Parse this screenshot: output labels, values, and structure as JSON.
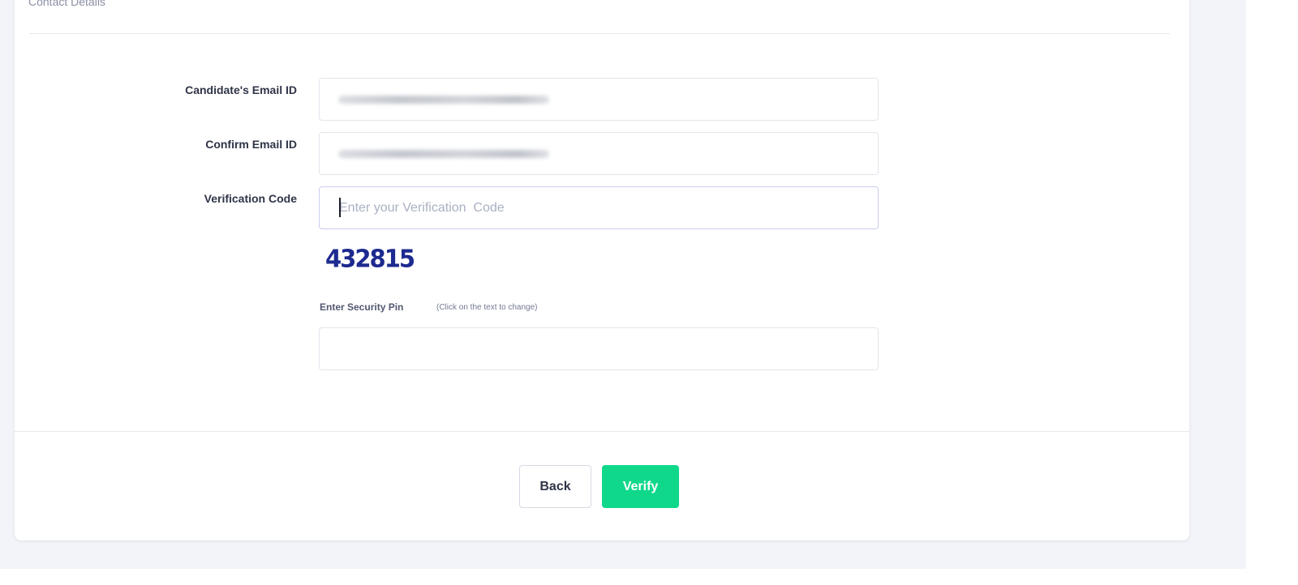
{
  "section": {
    "title": "Contact Details"
  },
  "form": {
    "email_label": "Candidate's Email ID",
    "confirm_email_label": "Confirm Email ID",
    "verification_label": "Verification Code",
    "verification_placeholder": "Enter your Verification  Code",
    "captcha_text": "432815",
    "security_pin_label": "Enter Security Pin",
    "security_pin_hint": "(Click on the text to change)"
  },
  "actions": {
    "back_label": "Back",
    "verify_label": "Verify"
  },
  "colors": {
    "accent": "#0fd88b",
    "captcha": "#1d2a8f",
    "page_background": "#f3f4f9"
  }
}
